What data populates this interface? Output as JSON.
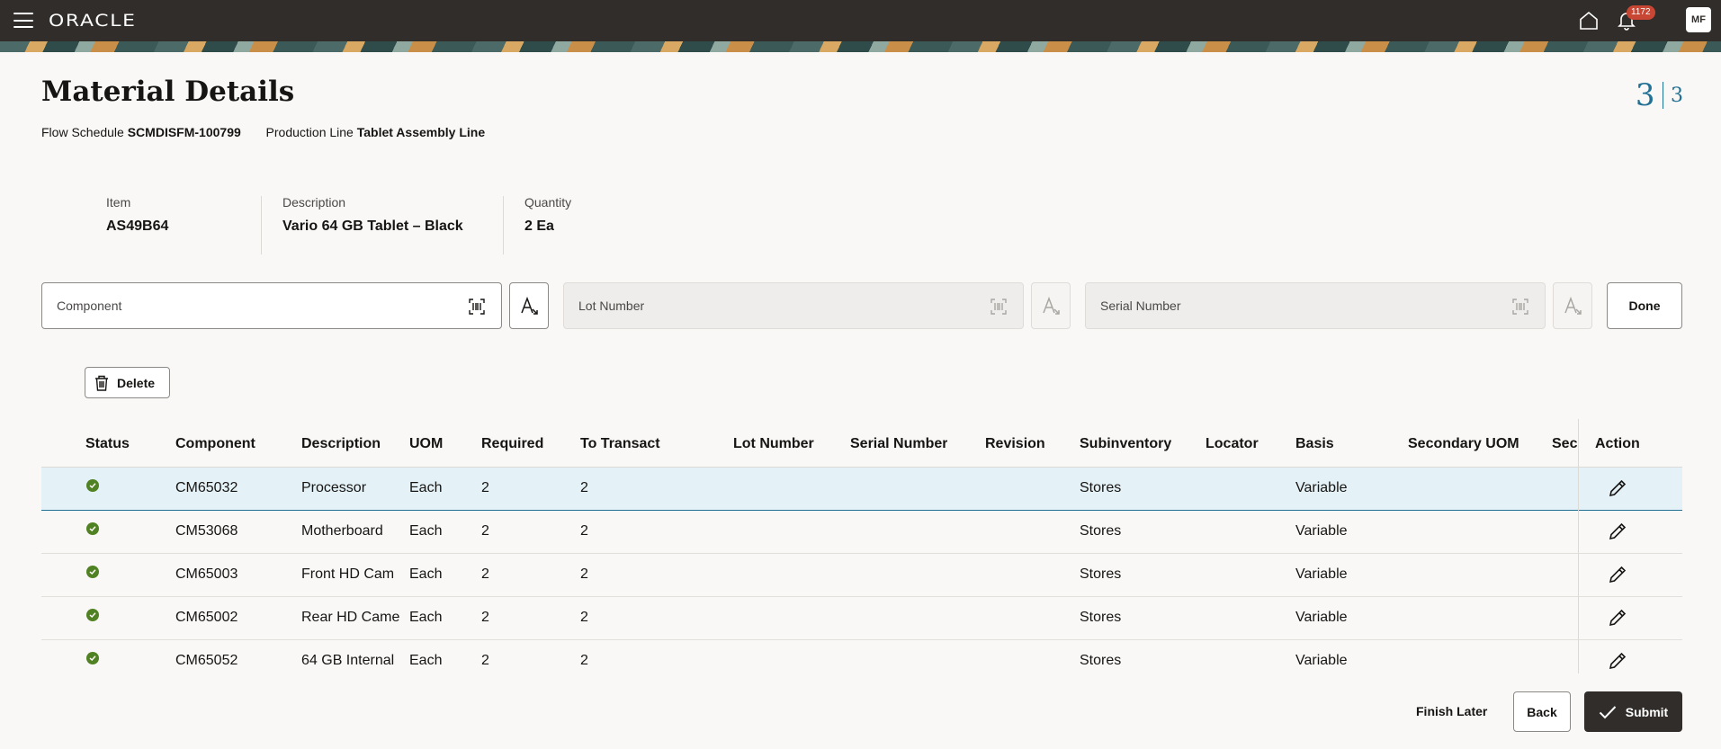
{
  "header": {
    "logo": "ORACLE",
    "notification_count": "1172",
    "user_initials": "MF"
  },
  "page": {
    "title": "Material Details",
    "flow_schedule_label": "Flow Schedule",
    "flow_schedule_value": "SCMDISFM-100799",
    "production_line_label": "Production Line",
    "production_line_value": "Tablet Assembly Line",
    "step_current": "3",
    "step_total": "3"
  },
  "item": {
    "item_label": "Item",
    "item_value": "AS49B64",
    "description_label": "Description",
    "description_value": "Vario 64 GB Tablet – Black",
    "quantity_label": "Quantity",
    "quantity_value": "2 Ea"
  },
  "scan_fields": {
    "component_placeholder": "Component",
    "lot_placeholder": "Lot Number",
    "serial_placeholder": "Serial Number",
    "done_label": "Done"
  },
  "toolbar": {
    "delete_label": "Delete"
  },
  "table": {
    "columns": [
      "Status",
      "Component",
      "Description",
      "UOM",
      "Required",
      "To Transact",
      "Lot Number",
      "Serial Number",
      "Revision",
      "Subinventory",
      "Locator",
      "Basis",
      "Secondary UOM",
      "Seco",
      "Action"
    ],
    "rows": [
      {
        "component": "CM65032",
        "description": "Processor",
        "uom": "Each",
        "required": "2",
        "to_transact": "2",
        "subinventory": "Stores",
        "basis": "Variable"
      },
      {
        "component": "CM53068",
        "description": "Motherboard",
        "uom": "Each",
        "required": "2",
        "to_transact": "2",
        "subinventory": "Stores",
        "basis": "Variable"
      },
      {
        "component": "CM65003",
        "description": "Front HD Cam",
        "uom": "Each",
        "required": "2",
        "to_transact": "2",
        "subinventory": "Stores",
        "basis": "Variable"
      },
      {
        "component": "CM65002",
        "description": "Rear HD Came",
        "uom": "Each",
        "required": "2",
        "to_transact": "2",
        "subinventory": "Stores",
        "basis": "Variable"
      },
      {
        "component": "CM65052",
        "description": "64 GB Internal",
        "uom": "Each",
        "required": "2",
        "to_transact": "2",
        "subinventory": "Stores",
        "basis": "Variable"
      }
    ]
  },
  "footer": {
    "finish_later_label": "Finish Later",
    "back_label": "Back",
    "submit_label": "Submit"
  },
  "colors": {
    "header_bg": "#312d2a",
    "accent": "#227093",
    "status_ok": "#508223",
    "badge": "#c74634",
    "selected_row": "#e4f1f7"
  }
}
